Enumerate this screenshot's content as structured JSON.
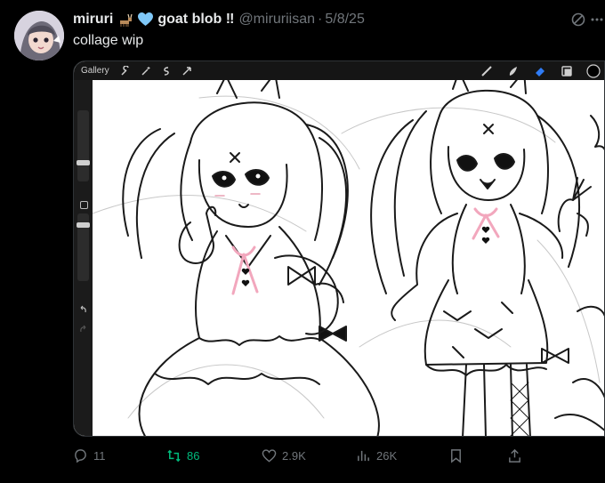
{
  "post": {
    "display_name": "miruri",
    "handle": "@miruriisan",
    "date": "5/8/25",
    "badge_text": "goat blob ‼",
    "text": "collage wip"
  },
  "media": {
    "gallery_label": "Gallery"
  },
  "actions": {
    "replies": "11",
    "reposts": "86",
    "likes": "2.9K",
    "views": "26K"
  },
  "colors": {
    "accent_repost": "#00ba7c",
    "muted": "#71767b",
    "heart_emoji": "#7fc8f8",
    "pink_ribbon": "#f6b3c6",
    "pen_tool": "#2f7cf6"
  },
  "icons": [
    "goat-emoji-icon",
    "blue-heart-icon",
    "grok-icon",
    "more-icon",
    "wrench-icon",
    "magic-wand-icon",
    "selection-icon",
    "transform-icon",
    "brush-icon",
    "smudge-icon",
    "eraser-icon",
    "layers-icon",
    "color-swatch-icon",
    "undo-icon",
    "redo-icon",
    "reply-icon",
    "repost-icon",
    "like-icon",
    "views-icon",
    "bookmark-icon",
    "share-icon"
  ]
}
